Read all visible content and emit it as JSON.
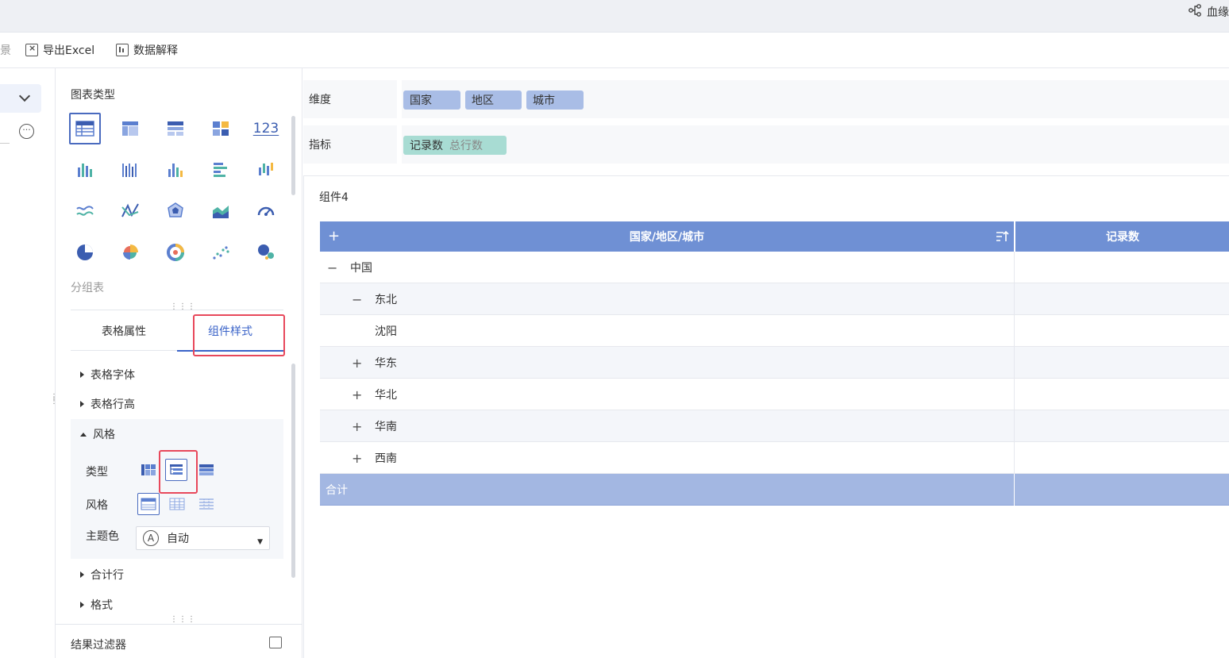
{
  "topbar": {
    "lineage_label": "血缘"
  },
  "toolbar": {
    "cut_label": "景",
    "export_label": "导出Excel",
    "explain_label": "数据解释"
  },
  "config": {
    "chart_type_title": "图表类型",
    "chart_icons": [
      "table-icon",
      "pivot-table-icon",
      "detail-table-icon",
      "card-table-icon",
      "kpi-icon",
      "stacked-bar-icon",
      "grouped-bar-icon",
      "column-icon",
      "bar-icon",
      "range-column-icon",
      "line-icon",
      "scatter-line-icon",
      "radar-icon",
      "area-icon",
      "gauge-icon",
      "pie-icon",
      "rose-icon",
      "ring-icon",
      "scatter-icon",
      "bubble-icon"
    ],
    "kpi_text": "123",
    "group_table_label": "分组表",
    "tab_table_props": "表格属性",
    "tab_component_style": "组件样式",
    "props": {
      "font": "表格字体",
      "row_height": "表格行高",
      "style": "风格",
      "type_label": "类型",
      "style_label": "风格",
      "theme_label": "主题色",
      "theme_value": "自动",
      "theme_icon_text": "A",
      "total_row": "合计行",
      "format": "格式"
    },
    "result_filter": "结果过滤器"
  },
  "fields": {
    "dimension_label": "维度",
    "dimensions": [
      "国家",
      "地区",
      "城市"
    ],
    "measure_label": "指标",
    "measure_name": "记录数",
    "measure_agg": "总行数"
  },
  "widget": {
    "title": "组件4",
    "header_col1": "国家/地区/城市",
    "header_col2": "记录数",
    "header_plus": "+",
    "rows": [
      {
        "label": "中国",
        "toggle": "−",
        "level": 0
      },
      {
        "label": "东北",
        "toggle": "−",
        "level": 1
      },
      {
        "label": "沈阳",
        "toggle": "",
        "level": 2
      },
      {
        "label": "华东",
        "toggle": "+",
        "level": 1
      },
      {
        "label": "华北",
        "toggle": "+",
        "level": 1
      },
      {
        "label": "华南",
        "toggle": "+",
        "level": 1
      },
      {
        "label": "西南",
        "toggle": "+",
        "level": 1
      }
    ],
    "total_label": "合计"
  },
  "colors": {
    "accent": "#3a63c8",
    "header_bg": "#6f90d4",
    "total_bg": "#a3b7e2",
    "dim_chip": "#a9bde6",
    "measure_chip": "#a8dcd3",
    "highlight": "#e8485b"
  }
}
